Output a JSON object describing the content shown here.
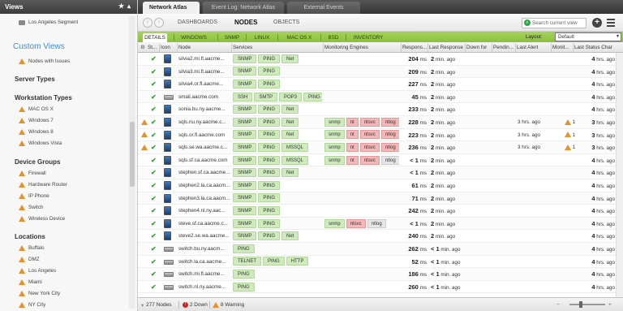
{
  "sidebar": {
    "title": "Views",
    "first_item": "Los Angeles Segment",
    "custom_views": "Custom Views",
    "nodes_with_issues": "Nodes with Issues",
    "server_types": "Server Types",
    "workstation_types": "Workstation Types",
    "workstations": [
      "MAC OS X",
      "Windows 7",
      "Windows 8",
      "Windows Vista"
    ],
    "device_groups": "Device Groups",
    "devices": [
      "Firewall",
      "Hardware Router",
      "IP Phone",
      "Switch",
      "Wireless Device"
    ],
    "locations": "Locations",
    "location_items": [
      "Buffalo",
      "DMZ",
      "Los Angeles",
      "Miami",
      "New York City",
      "NY City"
    ]
  },
  "topbar": {
    "tabs": [
      "Network Atlas",
      "Event Log: Network Atlas",
      "External Events"
    ]
  },
  "nav": {
    "links": [
      "DASHBOARDS",
      "NODES",
      "OBJECTS"
    ],
    "search_placeholder": "Search current view"
  },
  "filter": {
    "tabs": [
      "DETAILS",
      "WINDOWS",
      "SNMP",
      "LINUX",
      "MAC OS X",
      "BSD",
      "INVENTORY"
    ],
    "layout_label": "Layout:",
    "layout_value": "Default"
  },
  "columns": [
    "St...",
    "Icon",
    "Node",
    "Services",
    "Monitoring Engines",
    "Respons...",
    "Last Response",
    "Down for",
    "Pendin...",
    "Last Alert",
    "Monit...",
    "Last Status Char"
  ],
  "rows": [
    {
      "warn": false,
      "node": "silvia2.mi.fl.aacme...",
      "svc": [
        "SNMP",
        "PING",
        "Net"
      ],
      "me": [],
      "resp": "204",
      "respunit": "ms",
      "last": "2",
      "lastunit": "min. ago",
      "alert": "",
      "mon": "",
      "lsc": "4",
      "lscunit": "hrs. ago",
      "icon": "ws"
    },
    {
      "warn": false,
      "node": "silvia3.mi.fl.aacme...",
      "svc": [
        "SNMP",
        "PING"
      ],
      "me": [],
      "resp": "209",
      "respunit": "ms",
      "last": "2",
      "lastunit": "min. ago",
      "alert": "",
      "mon": "",
      "lsc": "4",
      "lscunit": "hrs. ago",
      "icon": "ws"
    },
    {
      "warn": false,
      "node": "silvia4.or.fl.aacme...",
      "svc": [
        "SNMP",
        "PING"
      ],
      "me": [],
      "resp": "227",
      "respunit": "ms",
      "last": "2",
      "lastunit": "min. ago",
      "alert": "",
      "mon": "",
      "lsc": "4",
      "lscunit": "hrs. ago",
      "icon": "ws"
    },
    {
      "warn": false,
      "node": "smail.aacme.com",
      "svc": [
        "SSH",
        "SMTP",
        "POP3",
        "PING",
        "linux"
      ],
      "me": [],
      "resp": "45",
      "respunit": "ms",
      "last": "2",
      "lastunit": "min. ago",
      "alert": "",
      "mon": "",
      "lsc": "4",
      "lscunit": "hrs. ago",
      "icon": "srv"
    },
    {
      "warn": false,
      "node": "sonia.bu.ny.aacme...",
      "svc": [
        "SNMP",
        "PING",
        "Net"
      ],
      "me": [],
      "resp": "233",
      "respunit": "ms",
      "last": "2",
      "lastunit": "min. ago",
      "alert": "",
      "mon": "",
      "lsc": "4",
      "lscunit": "hrs. ago",
      "icon": "ws"
    },
    {
      "warn": true,
      "node": "sqls.nu.ny.aacme.c...",
      "svc": [
        "SNMP",
        "PING",
        "Net"
      ],
      "me": [
        "snmp",
        "nt",
        "ntsvc",
        "ntlog"
      ],
      "resp": "228",
      "respunit": "ms",
      "last": "2",
      "lastunit": "min. ago",
      "alert": "3",
      "mon": "1",
      "lsc": "3",
      "lscunit": "hrs. ago",
      "icon": "ws"
    },
    {
      "warn": true,
      "node": "sqls.or.fl.aacme.com",
      "svc": [
        "SNMP",
        "PING",
        "Net"
      ],
      "me": [
        "snmp",
        "nt",
        "ntsvc",
        "ntlog"
      ],
      "resp": "223",
      "respunit": "ms",
      "last": "2",
      "lastunit": "min. ago",
      "alert": "3",
      "mon": "1",
      "lsc": "3",
      "lscunit": "hrs. ago",
      "icon": "ws"
    },
    {
      "warn": true,
      "node": "sqls.se.wa.aacme.c...",
      "svc": [
        "SNMP",
        "PING",
        "MSSQL"
      ],
      "me": [
        "snmp",
        "nt",
        "ntsvc",
        "ntlog"
      ],
      "resp": "236",
      "respunit": "ms",
      "last": "2",
      "lastunit": "min. ago",
      "alert": "3",
      "mon": "1",
      "lsc": "3",
      "lscunit": "hrs. ago",
      "icon": "ws"
    },
    {
      "warn": false,
      "node": "sqls.sf.ca.aacme.com",
      "svc": [
        "SNMP",
        "PING",
        "MSSQL"
      ],
      "me": [
        "snmp",
        "nt",
        "ntsvc",
        "ntlog"
      ],
      "resp": "< 1",
      "respunit": "ms",
      "last": "2",
      "lastunit": "min. ago",
      "alert": "",
      "mon": "",
      "lsc": "4",
      "lscunit": "hrs. ago",
      "icon": "ws"
    },
    {
      "warn": false,
      "node": "stephen.sf.ca.aacme...",
      "svc": [
        "SNMP",
        "PING",
        "Net"
      ],
      "me": [],
      "resp": "< 1",
      "respunit": "ms",
      "last": "2",
      "lastunit": "min. ago",
      "alert": "",
      "mon": "",
      "lsc": "4",
      "lscunit": "hrs. ago",
      "icon": "ws"
    },
    {
      "warn": false,
      "node": "stephen2.la.ca.aacm...",
      "svc": [
        "SNMP",
        "PING"
      ],
      "me": [],
      "resp": "61",
      "respunit": "ms",
      "last": "2",
      "lastunit": "min. ago",
      "alert": "",
      "mon": "",
      "lsc": "4",
      "lscunit": "hrs. ago",
      "icon": "ws"
    },
    {
      "warn": false,
      "node": "stephen3.la.ca.aacm...",
      "svc": [
        "SNMP",
        "PING"
      ],
      "me": [],
      "resp": "71",
      "respunit": "ms",
      "last": "2",
      "lastunit": "min. ago",
      "alert": "",
      "mon": "",
      "lsc": "4",
      "lscunit": "hrs. ago",
      "icon": "ws"
    },
    {
      "warn": false,
      "node": "stephen4.nl.ny.aac...",
      "svc": [
        "SNMP",
        "PING"
      ],
      "me": [],
      "resp": "242",
      "respunit": "ms",
      "last": "2",
      "lastunit": "min. ago",
      "alert": "",
      "mon": "",
      "lsc": "4",
      "lscunit": "hrs. ago",
      "icon": "ws"
    },
    {
      "warn": false,
      "node": "steve.sf.ca.aacme.c...",
      "svc": [
        "SNMP",
        "PING"
      ],
      "me": [
        "snmp",
        "ntsvc",
        "ntlog"
      ],
      "resp": "< 1",
      "respunit": "ms",
      "last": "2",
      "lastunit": "min. ago",
      "alert": "",
      "mon": "",
      "lsc": "4",
      "lscunit": "hrs. ago",
      "icon": "ws"
    },
    {
      "warn": false,
      "node": "steve2.se.wa.aacme...",
      "svc": [
        "SNMP",
        "PING",
        "Net"
      ],
      "me": [],
      "resp": "240",
      "respunit": "ms",
      "last": "2",
      "lastunit": "min. ago",
      "alert": "",
      "mon": "",
      "lsc": "4",
      "lscunit": "hrs. ago",
      "icon": "ws"
    },
    {
      "warn": false,
      "node": "switch.bu.ny.aacm...",
      "svc": [
        "PING"
      ],
      "me": [],
      "resp": "262",
      "respunit": "ms",
      "last": "< 1",
      "lastunit": "min. ago",
      "alert": "",
      "mon": "",
      "lsc": "4",
      "lscunit": "hrs. ago",
      "icon": "srv"
    },
    {
      "warn": false,
      "node": "switch.la.ca.aacme...",
      "svc": [
        "TELNET",
        "PING",
        "HTTP"
      ],
      "me": [],
      "resp": "52",
      "respunit": "ms",
      "last": "< 1",
      "lastunit": "min. ago",
      "alert": "",
      "mon": "",
      "lsc": "4",
      "lscunit": "hrs. ago",
      "icon": "srv"
    },
    {
      "warn": false,
      "node": "switch.mi.fl.aacme...",
      "svc": [
        "PING"
      ],
      "me": [],
      "resp": "186",
      "respunit": "ms",
      "last": "< 1",
      "lastunit": "min. ago",
      "alert": "",
      "mon": "",
      "lsc": "4",
      "lscunit": "hrs. ago",
      "icon": "srv"
    },
    {
      "warn": false,
      "node": "switch.nl.ny.aacme...",
      "svc": [
        "PING"
      ],
      "me": [],
      "resp": "260",
      "respunit": "ms",
      "last": "< 1",
      "lastunit": "min. ago",
      "alert": "",
      "mon": "",
      "lsc": "4",
      "lscunit": "hrs. ago",
      "icon": "srv"
    }
  ],
  "status": {
    "nodes": "277 Nodes",
    "down": "2 Down",
    "warning": "8 Warning"
  },
  "colors": {
    "accent": "#8ac03a",
    "warning": "#e8902a",
    "error": "#d42020",
    "link": "#3a8fd0"
  }
}
